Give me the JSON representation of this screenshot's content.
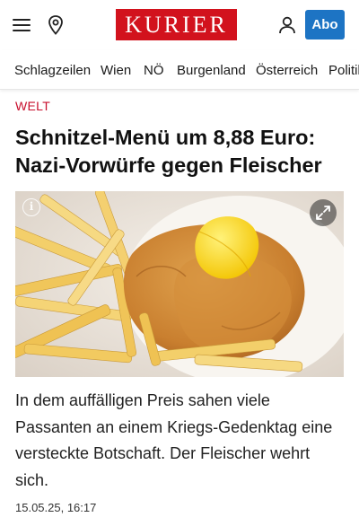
{
  "header": {
    "logo_text": "KURIER",
    "abo_label": "Abo",
    "colors": {
      "brand": "#d2121d",
      "abo": "#1d74c4"
    },
    "icons": [
      "menu-icon",
      "location-pin-icon",
      "user-icon"
    ]
  },
  "nav": {
    "items": [
      {
        "label": "Schlagzeilen"
      },
      {
        "label": "Wien"
      },
      {
        "label": "NÖ"
      },
      {
        "label": "Burgenland"
      },
      {
        "label": "Österreich"
      },
      {
        "label": "Politik"
      }
    ]
  },
  "article": {
    "category": "WELT",
    "category_color": "#c8102e",
    "headline": "Schnitzel-Menü um 8,88 Euro: Nazi-Vorwürfe gegen Fleischer",
    "image_icons": [
      "info-icon",
      "expand-icon"
    ],
    "lead": "In dem auffälligen Preis sahen viele Passanten an einem Kriegs-Gedenktag eine versteckte Botschaft. Der Fleischer wehrt sich.",
    "date": "15.05.25, 16:17"
  }
}
